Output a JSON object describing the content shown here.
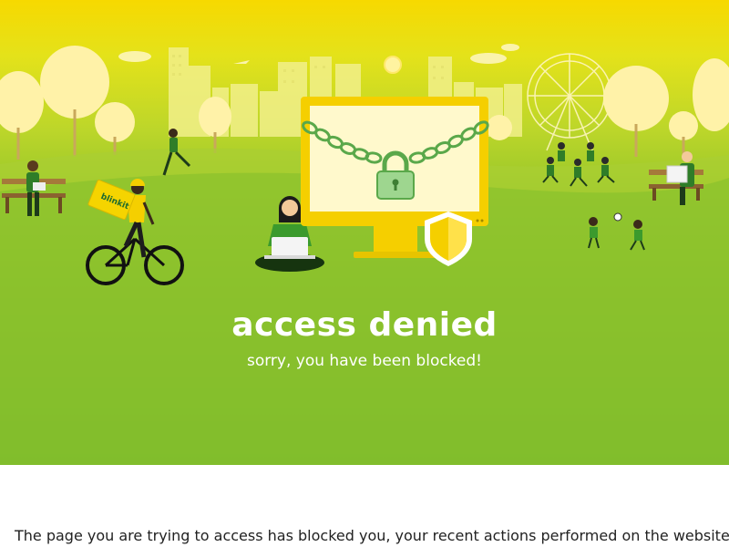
{
  "hero": {
    "title": "access denied",
    "subtitle": "sorry, you have been blocked!",
    "delivery_bag_label": "blinkit"
  },
  "body": {
    "message": "The page you are trying to access has blocked you, your recent actions performed on the website"
  },
  "colors": {
    "sky_top": "#f7d900",
    "grass_bottom": "#0e8a24",
    "monitor_yellow": "#f5cf00",
    "lock_green": "#7cc47a",
    "text_white": "#ffffff",
    "body_text": "#222222"
  },
  "icons": {
    "lock": "padlock-icon",
    "shield": "shield-icon"
  }
}
